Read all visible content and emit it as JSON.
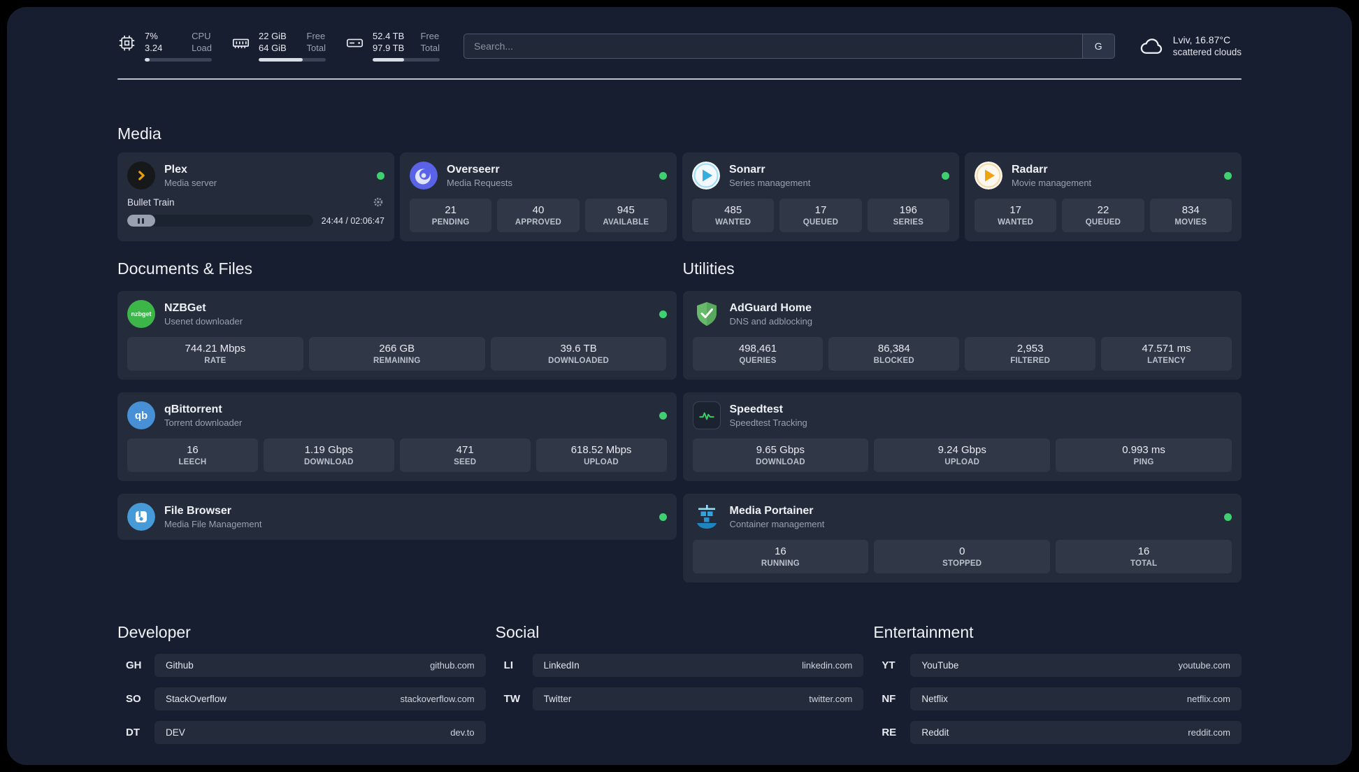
{
  "colors": {
    "status_online": "#3fd06f",
    "plex_accent": "#e5a00d",
    "adguard_green": "#68ba6b"
  },
  "topbar": {
    "cpu": {
      "line1": "7%",
      "line2": "3.24",
      "label1": "CPU",
      "label2": "Load",
      "progress": 7
    },
    "ram": {
      "line1": "22 GiB",
      "line2": "64 GiB",
      "label1": "Free",
      "label2": "Total",
      "progress": 66
    },
    "disk": {
      "line1": "52.4 TB",
      "line2": "97.9 TB",
      "label1": "Free",
      "label2": "Total",
      "progress": 47
    },
    "search": {
      "placeholder": "Search...",
      "button": "G"
    },
    "weather": {
      "location": "Lviv, 16.87°C",
      "condition": "scattered clouds"
    }
  },
  "media": {
    "heading": "Media",
    "plex": {
      "title": "Plex",
      "subtitle": "Media server",
      "now_playing": "Bullet Train",
      "time": "24:44 / 02:06:47",
      "progress": 15
    },
    "overseerr": {
      "title": "Overseerr",
      "subtitle": "Media Requests",
      "stats": [
        {
          "value": "21",
          "label": "PENDING"
        },
        {
          "value": "40",
          "label": "APPROVED"
        },
        {
          "value": "945",
          "label": "AVAILABLE"
        }
      ]
    },
    "sonarr": {
      "title": "Sonarr",
      "subtitle": "Series management",
      "stats": [
        {
          "value": "485",
          "label": "WANTED"
        },
        {
          "value": "17",
          "label": "QUEUED"
        },
        {
          "value": "196",
          "label": "SERIES"
        }
      ]
    },
    "radarr": {
      "title": "Radarr",
      "subtitle": "Movie management",
      "stats": [
        {
          "value": "17",
          "label": "WANTED"
        },
        {
          "value": "22",
          "label": "QUEUED"
        },
        {
          "value": "834",
          "label": "MOVIES"
        }
      ]
    }
  },
  "documents": {
    "heading": "Documents & Files",
    "nzbget": {
      "title": "NZBGet",
      "subtitle": "Usenet downloader",
      "icon_text": "nzbget",
      "stats": [
        {
          "value": "744.21 Mbps",
          "label": "RATE"
        },
        {
          "value": "266 GB",
          "label": "REMAINING"
        },
        {
          "value": "39.6 TB",
          "label": "DOWNLOADED"
        }
      ]
    },
    "qbittorrent": {
      "title": "qBittorrent",
      "subtitle": "Torrent downloader",
      "icon_text": "qb",
      "stats": [
        {
          "value": "16",
          "label": "LEECH"
        },
        {
          "value": "1.19 Gbps",
          "label": "DOWNLOAD"
        },
        {
          "value": "471",
          "label": "SEED"
        },
        {
          "value": "618.52 Mbps",
          "label": "UPLOAD"
        }
      ]
    },
    "filebrowser": {
      "title": "File Browser",
      "subtitle": "Media File Management"
    }
  },
  "utilities": {
    "heading": "Utilities",
    "adguard": {
      "title": "AdGuard Home",
      "subtitle": "DNS and adblocking",
      "stats": [
        {
          "value": "498,461",
          "label": "QUERIES"
        },
        {
          "value": "86,384",
          "label": "BLOCKED"
        },
        {
          "value": "2,953",
          "label": "FILTERED"
        },
        {
          "value": "47.571 ms",
          "label": "LATENCY"
        }
      ]
    },
    "speedtest": {
      "title": "Speedtest",
      "subtitle": "Speedtest Tracking",
      "stats": [
        {
          "value": "9.65 Gbps",
          "label": "DOWNLOAD"
        },
        {
          "value": "9.24 Gbps",
          "label": "UPLOAD"
        },
        {
          "value": "0.993 ms",
          "label": "PING"
        }
      ]
    },
    "portainer": {
      "title": "Media Portainer",
      "subtitle": "Container management",
      "stats": [
        {
          "value": "16",
          "label": "RUNNING"
        },
        {
          "value": "0",
          "label": "STOPPED"
        },
        {
          "value": "16",
          "label": "TOTAL"
        }
      ]
    }
  },
  "bookmarks": {
    "developer": {
      "heading": "Developer",
      "items": [
        {
          "abbr": "GH",
          "name": "Github",
          "url": "github.com"
        },
        {
          "abbr": "SO",
          "name": "StackOverflow",
          "url": "stackoverflow.com"
        },
        {
          "abbr": "DT",
          "name": "DEV",
          "url": "dev.to"
        }
      ]
    },
    "social": {
      "heading": "Social",
      "items": [
        {
          "abbr": "LI",
          "name": "LinkedIn",
          "url": "linkedin.com"
        },
        {
          "abbr": "TW",
          "name": "Twitter",
          "url": "twitter.com"
        }
      ]
    },
    "entertainment": {
      "heading": "Entertainment",
      "items": [
        {
          "abbr": "YT",
          "name": "YouTube",
          "url": "youtube.com"
        },
        {
          "abbr": "NF",
          "name": "Netflix",
          "url": "netflix.com"
        },
        {
          "abbr": "RE",
          "name": "Reddit",
          "url": "reddit.com"
        }
      ]
    }
  }
}
